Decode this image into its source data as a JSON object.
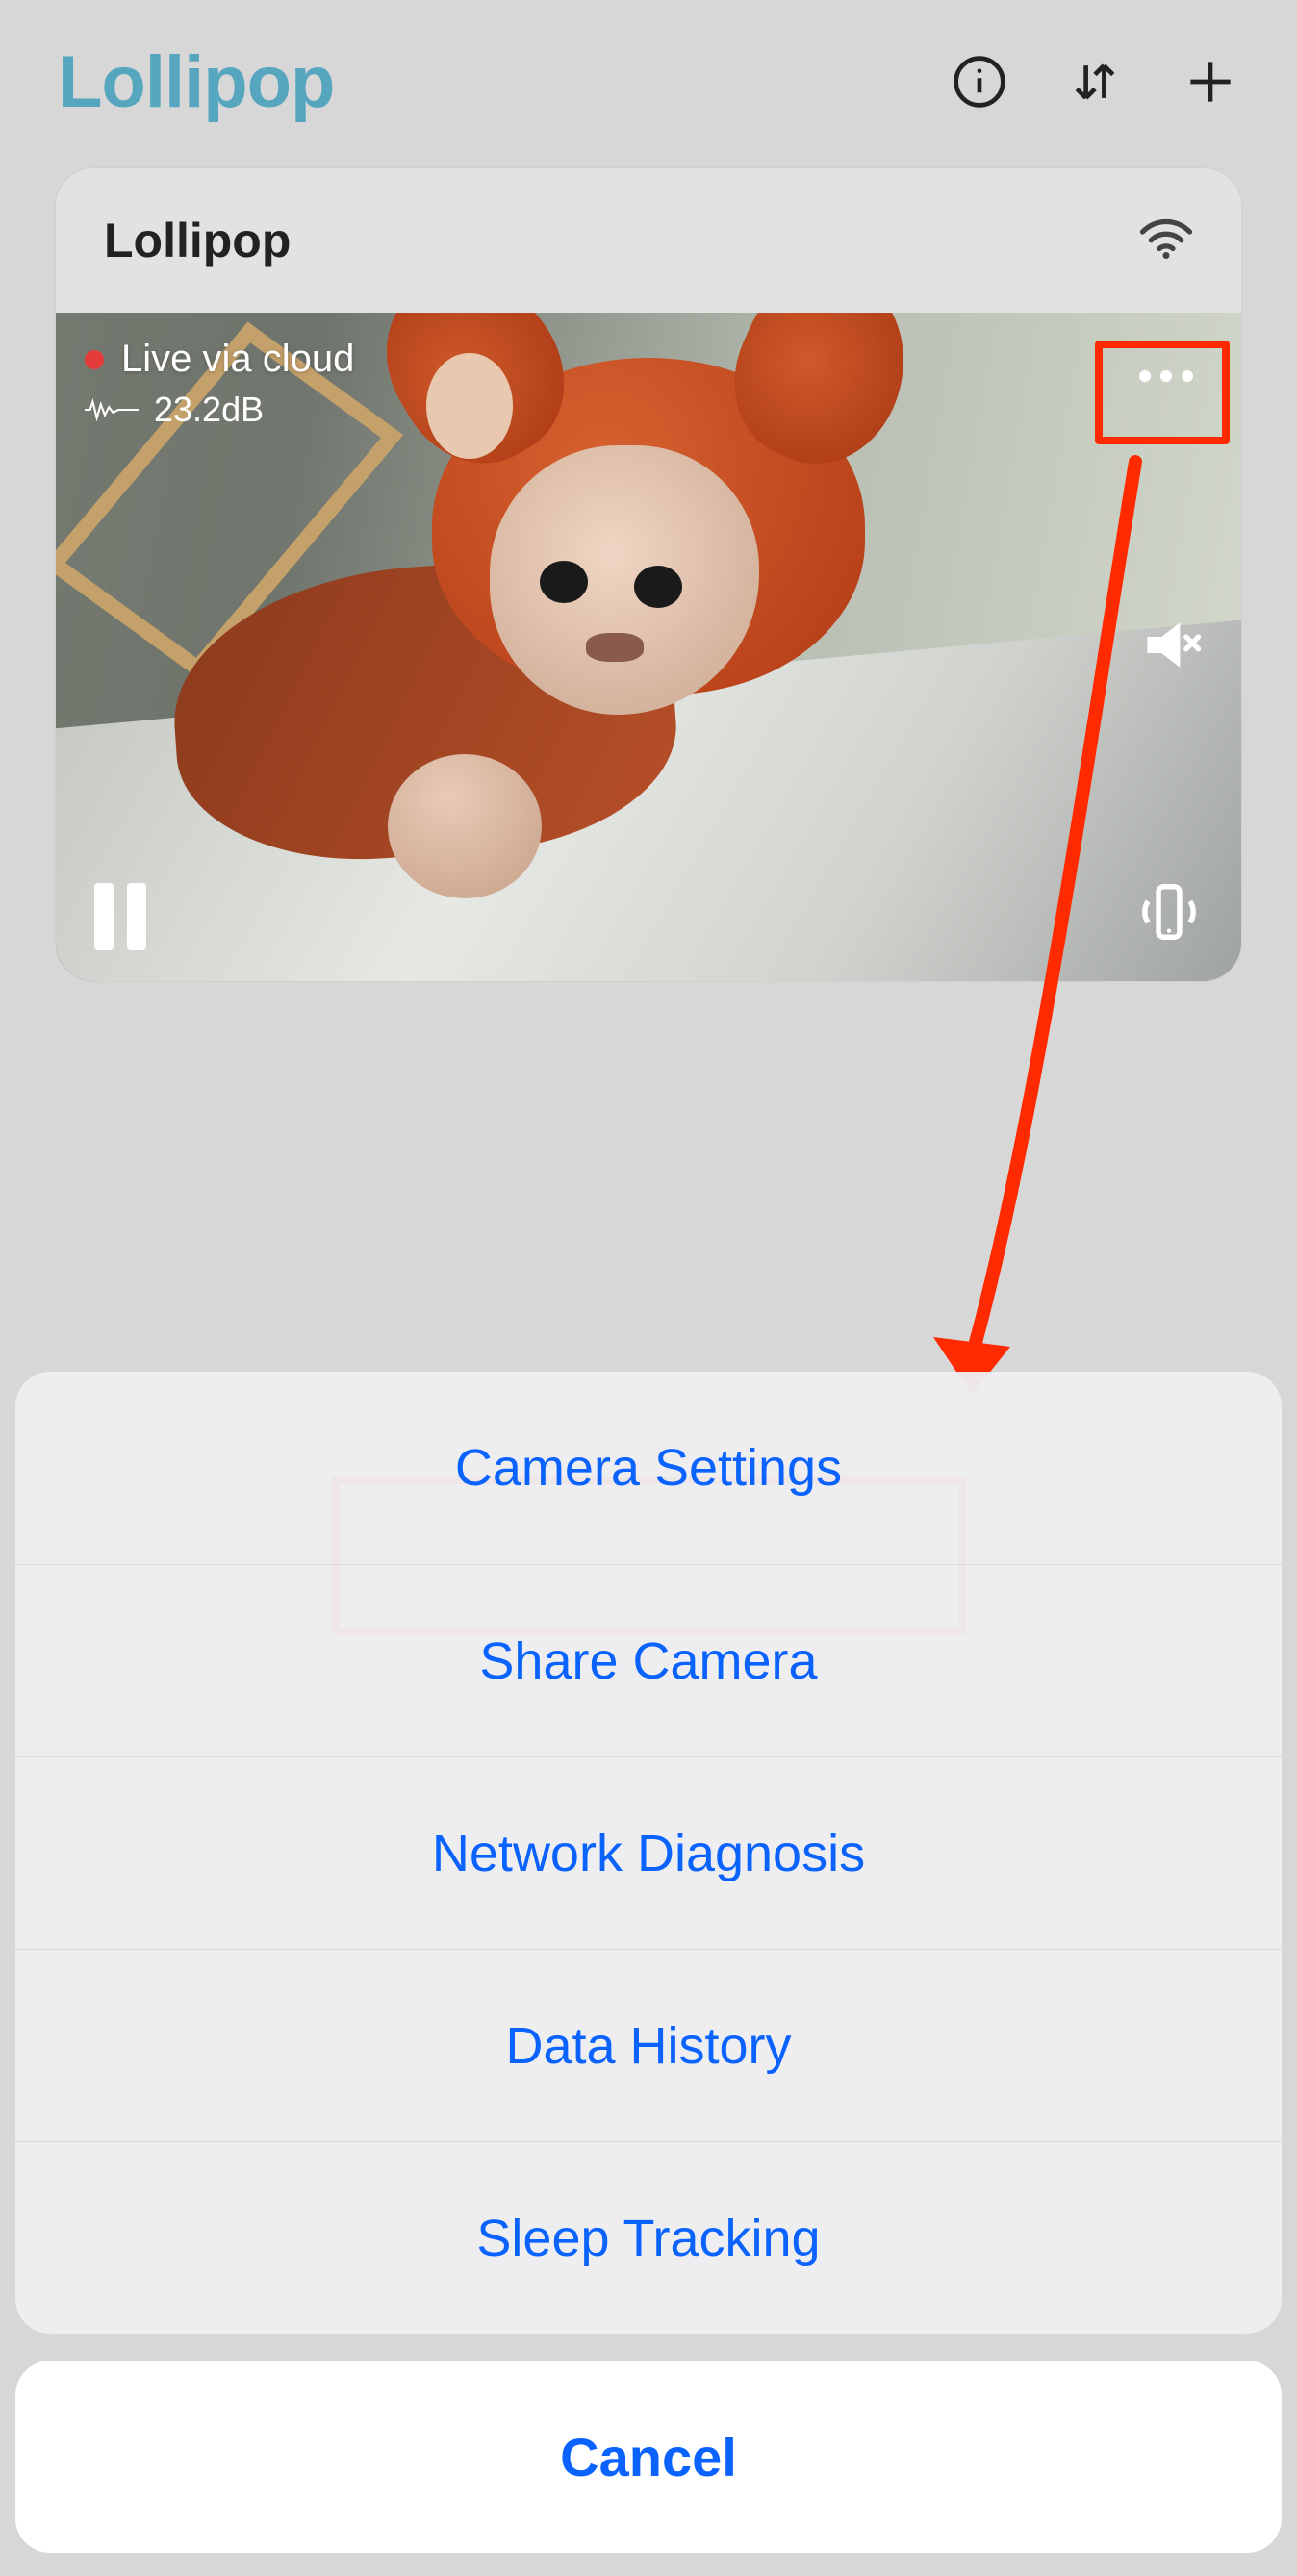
{
  "header": {
    "brand": "Lollipop",
    "icons": {
      "info": "info-icon",
      "sort": "sort-icon",
      "add": "plus-icon"
    }
  },
  "camera": {
    "name": "Lollipop",
    "live_status": "Live via cloud",
    "db_reading": "23.2dB",
    "controls": {
      "more": "more-icon",
      "mute": "mute-icon",
      "pause": "pause-icon",
      "vibrate": "phone-vibrate-icon"
    }
  },
  "annotation": {
    "highlight_target": "more-button",
    "highlight_menu_item": "Camera Settings",
    "color": "#ff2a00"
  },
  "action_sheet": {
    "items": [
      "Camera Settings",
      "Share Camera",
      "Network Diagnosis",
      "Data History",
      "Sleep Tracking"
    ],
    "cancel": "Cancel",
    "accent": "#0a63ff"
  }
}
